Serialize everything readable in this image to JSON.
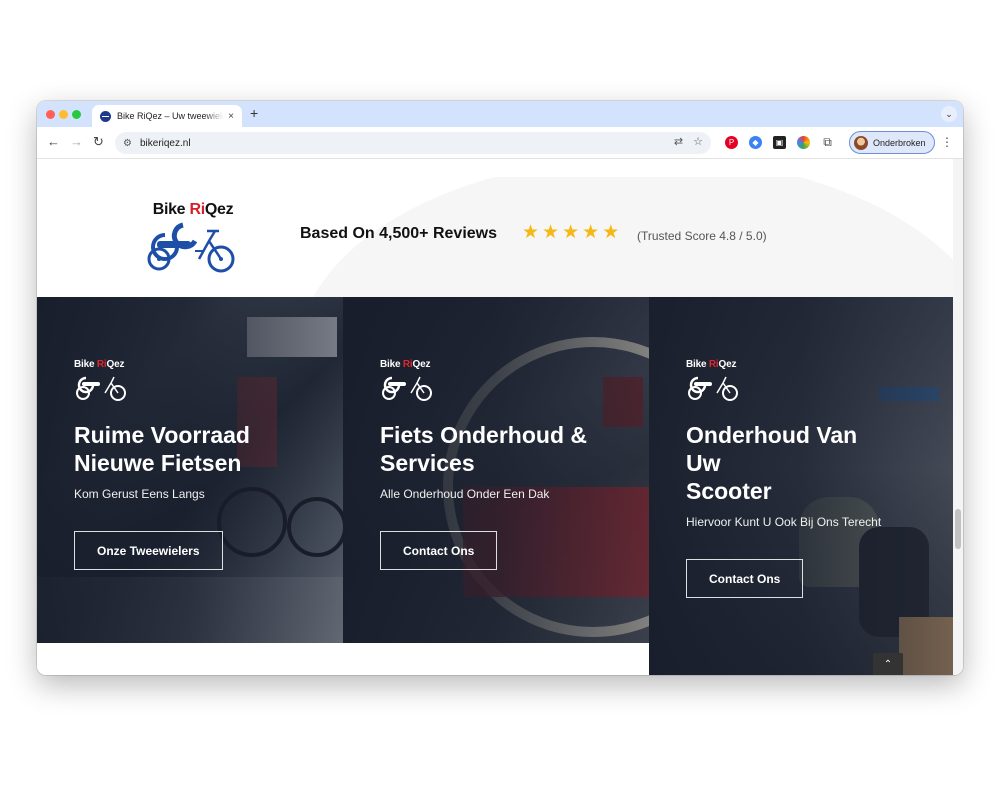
{
  "browser": {
    "tab_title": "Bike RiQez – Uw tweewieler specialist",
    "tab_close": "×",
    "new_tab": "+",
    "tab_menu": "⌄",
    "url": "bikeriqez.nl",
    "profile_name": "Onderbroken",
    "icons": [
      "back-icon",
      "forward-icon",
      "reload-icon",
      "site-settings-icon",
      "translate-icon",
      "star-icon",
      "pinterest-icon",
      "extension-icon",
      "puzzle-icon",
      "menu-icon"
    ]
  },
  "header": {
    "logo_text_prefix": "Bike ",
    "logo_text_highlight": "Ri",
    "logo_text_suffix": "Qez",
    "reviews_text": "Based On 4,500+ Reviews",
    "stars": "★★★★★",
    "trusted_score": "(Trusted Score 4.8 / 5.0)",
    "rating": 5
  },
  "cards": [
    {
      "logo_prefix": "Bike ",
      "logo_highlight": "Ri",
      "logo_suffix": "Qez",
      "title": "Ruime Voorraad\nNieuwe Fietsen",
      "subtitle": "Kom Gerust Eens Langs",
      "button": "Onze Tweewielers"
    },
    {
      "logo_prefix": "Bike ",
      "logo_highlight": "Ri",
      "logo_suffix": "Qez",
      "title": "Fiets Onderhoud &\nServices",
      "subtitle": "Alle Onderhoud Onder Een Dak",
      "button": "Contact Ons"
    },
    {
      "logo_prefix": "Bike ",
      "logo_highlight": "Ri",
      "logo_suffix": "Qez",
      "title": "Onderhoud Van\nUw\nScooter",
      "subtitle": "Hiervoor Kunt U Ook Bij Ons Terecht",
      "button": "Contact Ons"
    }
  ],
  "colors": {
    "brand_blue": "#1d4fa8",
    "brand_red": "#d4202a",
    "star": "#f5b816",
    "card_dark": "#161c2a"
  },
  "back_to_top": "⌃"
}
